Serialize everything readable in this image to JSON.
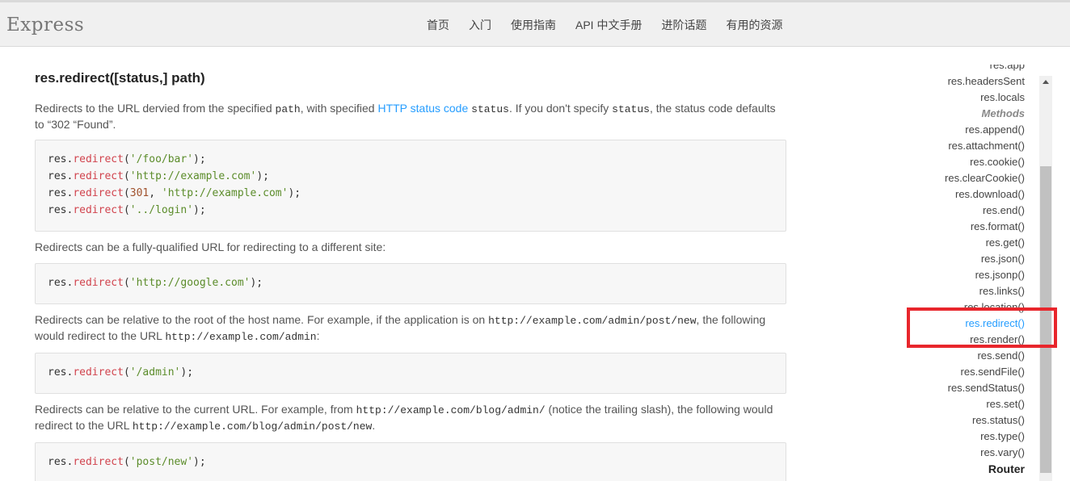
{
  "header": {
    "brand": "Express",
    "nav": [
      "首页",
      "入门",
      "使用指南",
      "API 中文手册",
      "进阶话题",
      "有用的资源"
    ]
  },
  "main": {
    "title": "res.redirect([status,] path)",
    "intro": {
      "p1": "Redirects to the URL dervied from the specified ",
      "code1": "path",
      "p2": ", with specified ",
      "link": "HTTP status code",
      "p3": " ",
      "code2": "status",
      "p4": ". If you don't specify ",
      "code3": "status",
      "p5": ", the status code defaults to “302 “Found”."
    },
    "code1": [
      [
        {
          "t": "res."
        },
        {
          "t": "redirect",
          "c": "fn"
        },
        {
          "t": "("
        },
        {
          "t": "'/foo/bar'",
          "c": "str"
        },
        {
          "t": ");"
        }
      ],
      [
        {
          "t": "res."
        },
        {
          "t": "redirect",
          "c": "fn"
        },
        {
          "t": "("
        },
        {
          "t": "'http://example.com'",
          "c": "str"
        },
        {
          "t": ");"
        }
      ],
      [
        {
          "t": "res."
        },
        {
          "t": "redirect",
          "c": "fn"
        },
        {
          "t": "("
        },
        {
          "t": "301",
          "c": "num"
        },
        {
          "t": ", "
        },
        {
          "t": "'http://example.com'",
          "c": "str"
        },
        {
          "t": ");"
        }
      ],
      [
        {
          "t": "res."
        },
        {
          "t": "redirect",
          "c": "fn"
        },
        {
          "t": "("
        },
        {
          "t": "'../login'",
          "c": "str"
        },
        {
          "t": ");"
        }
      ]
    ],
    "para2": "Redirects can be a fully-qualified URL for redirecting to a different site:",
    "code2": [
      [
        {
          "t": "res."
        },
        {
          "t": "redirect",
          "c": "fn"
        },
        {
          "t": "("
        },
        {
          "t": "'http://google.com'",
          "c": "str"
        },
        {
          "t": ");"
        }
      ]
    ],
    "para3": {
      "a": "Redirects can be relative to the root of the host name. For example, if the application is on ",
      "code_a": "http://example.com/admin/post/new",
      "b": ", the following would redirect to the URL ",
      "code_b": "http://example.com/admin",
      "c": ":"
    },
    "code3": [
      [
        {
          "t": "res."
        },
        {
          "t": "redirect",
          "c": "fn"
        },
        {
          "t": "("
        },
        {
          "t": "'/admin'",
          "c": "str"
        },
        {
          "t": ");"
        }
      ]
    ],
    "para4": {
      "a": "Redirects can be relative to the current URL. For example, from ",
      "code_a": "http://example.com/blog/admin/",
      "b": " (notice the trailing slash), the following would redirect to the URL ",
      "code_b": "http://example.com/blog/admin/post/new",
      "c": "."
    },
    "code4": [
      [
        {
          "t": "res."
        },
        {
          "t": "redirect",
          "c": "fn"
        },
        {
          "t": "("
        },
        {
          "t": "'post/new'",
          "c": "str"
        },
        {
          "t": ");"
        }
      ]
    ]
  },
  "sidebar": {
    "items": [
      {
        "label": "res.app",
        "kind": "item"
      },
      {
        "label": "res.headersSent",
        "kind": "item"
      },
      {
        "label": "res.locals",
        "kind": "item"
      },
      {
        "label": "Methods",
        "kind": "heading"
      },
      {
        "label": "res.append()",
        "kind": "item"
      },
      {
        "label": "res.attachment()",
        "kind": "item"
      },
      {
        "label": "res.cookie()",
        "kind": "item"
      },
      {
        "label": "res.clearCookie()",
        "kind": "item"
      },
      {
        "label": "res.download()",
        "kind": "item"
      },
      {
        "label": "res.end()",
        "kind": "item"
      },
      {
        "label": "res.format()",
        "kind": "item"
      },
      {
        "label": "res.get()",
        "kind": "item"
      },
      {
        "label": "res.json()",
        "kind": "item"
      },
      {
        "label": "res.jsonp()",
        "kind": "item"
      },
      {
        "label": "res.links()",
        "kind": "item"
      },
      {
        "label": "res.location()",
        "kind": "item"
      },
      {
        "label": "res.redirect()",
        "kind": "active"
      },
      {
        "label": "res.render()",
        "kind": "item"
      },
      {
        "label": "res.send()",
        "kind": "item"
      },
      {
        "label": "res.sendFile()",
        "kind": "item"
      },
      {
        "label": "res.sendStatus()",
        "kind": "item"
      },
      {
        "label": "res.set()",
        "kind": "item"
      },
      {
        "label": "res.status()",
        "kind": "item"
      },
      {
        "label": "res.type()",
        "kind": "item"
      },
      {
        "label": "res.vary()",
        "kind": "item"
      },
      {
        "label": "Router",
        "kind": "section"
      }
    ]
  },
  "colors": {
    "link": "#259dff",
    "highlight_box": "#e8262c",
    "code_function": "#d1444e",
    "code_string": "#5b8c2a"
  }
}
